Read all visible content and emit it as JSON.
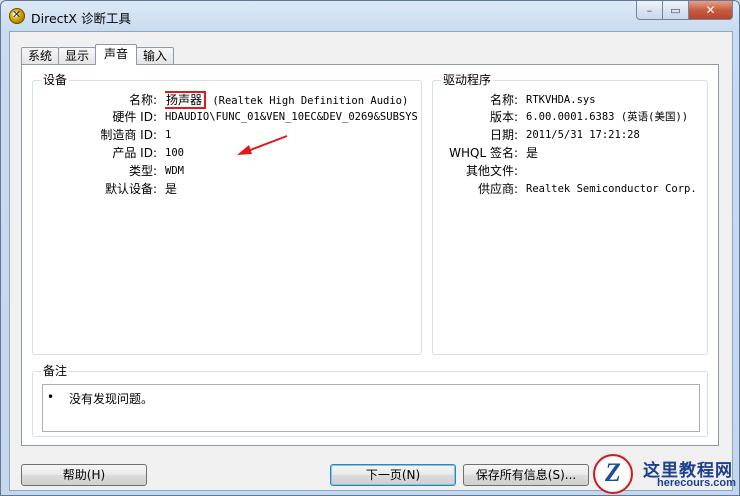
{
  "window": {
    "title": "DirectX 诊断工具"
  },
  "caption": {
    "minimize": "–",
    "maximize": "▭",
    "close": "✕"
  },
  "tabs": [
    {
      "label": "系统",
      "active": false
    },
    {
      "label": "显示",
      "active": false
    },
    {
      "label": "声音",
      "active": true
    },
    {
      "label": "输入",
      "active": false
    }
  ],
  "device": {
    "title": "设备",
    "rows": [
      {
        "label": "名称:",
        "value_highlight": "扬声器",
        "value": " (Realtek High Definition Audio)"
      },
      {
        "label": "硬件 ID:",
        "value": "HDAUDIO\\FUNC_01&VEN_10EC&DEV_0269&SUBSYS_"
      },
      {
        "label": "制造商 ID:",
        "value": "1"
      },
      {
        "label": "产品 ID:",
        "value": "100"
      },
      {
        "label": "类型:",
        "value": "WDM"
      },
      {
        "label": "默认设备:",
        "value": "是"
      }
    ]
  },
  "driver": {
    "title": "驱动程序",
    "rows": [
      {
        "label": "名称:",
        "value": "RTKVHDA.sys"
      },
      {
        "label": "版本:",
        "value": "6.00.0001.6383 (英语(美国))"
      },
      {
        "label": "日期:",
        "value": "2011/5/31 17:21:28"
      },
      {
        "label": "WHQL 签名:",
        "value": "是"
      },
      {
        "label": "其他文件:",
        "value": ""
      },
      {
        "label": "供应商:",
        "value": "Realtek Semiconductor Corp."
      }
    ]
  },
  "notes": {
    "title": "备注",
    "bullet": "•",
    "items": [
      "没有发现问题。"
    ]
  },
  "buttons": {
    "help": "帮助(H)",
    "next": "下一页(N)",
    "save": "保存所有信息(S)..."
  },
  "watermark": {
    "title": "这里教程网",
    "url": "herecours.com"
  },
  "colors": {
    "highlight": "#e0191b",
    "arrow": "#e0191b",
    "watermark": "#1e3f8a"
  }
}
